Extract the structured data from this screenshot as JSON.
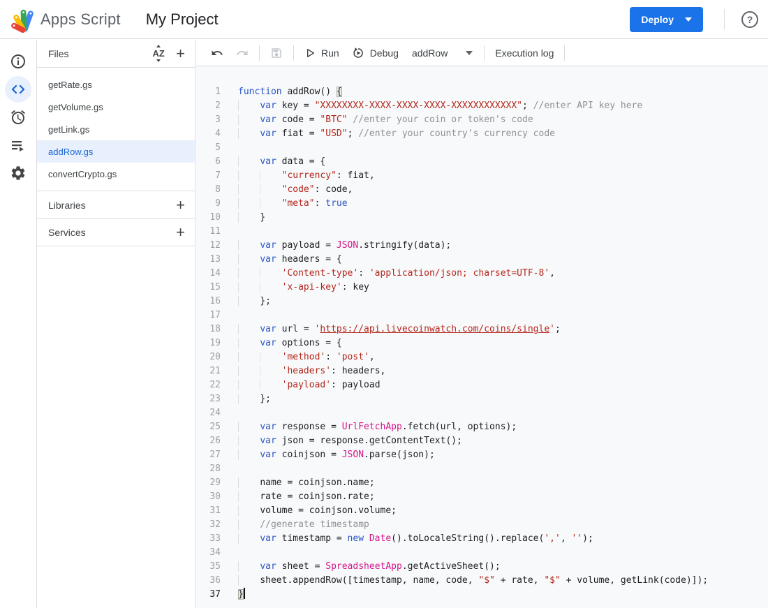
{
  "header": {
    "product": "Apps Script",
    "title": "My Project",
    "deploy_label": "Deploy",
    "help_icon": "help-icon"
  },
  "rail": {
    "items": [
      "overview",
      "editor",
      "triggers",
      "executions",
      "settings"
    ],
    "selected": "editor",
    "selected_color": "#1967d2",
    "icon_color": "#444746"
  },
  "files_panel": {
    "title": "Files",
    "sort_icon": "AZ",
    "files": [
      {
        "name": "getRate.gs",
        "selected": false
      },
      {
        "name": "getVolume.gs",
        "selected": false
      },
      {
        "name": "getLink.gs",
        "selected": false
      },
      {
        "name": "addRow.gs",
        "selected": true
      },
      {
        "name": "convertCrypto.gs",
        "selected": false
      }
    ],
    "sections": [
      {
        "label": "Libraries"
      },
      {
        "label": "Services"
      }
    ]
  },
  "toolbar": {
    "run_label": "Run",
    "debug_label": "Debug",
    "function_selector_value": "addRow",
    "execution_log_label": "Execution log"
  },
  "editor": {
    "active_line": 37,
    "syntax_colors": {
      "keyword": "#2a56c6",
      "string": "#b3261c",
      "comment": "#8e9297",
      "builtin": "#d6158a",
      "plain": "#202124"
    },
    "lines": [
      {
        "n": 1,
        "t": [
          [
            "k",
            "function"
          ],
          [
            "p",
            " addRow() "
          ],
          [
            "hb",
            "{"
          ]
        ]
      },
      {
        "n": 2,
        "t": [
          [
            "w",
            "    "
          ],
          [
            "k",
            "var"
          ],
          [
            "p",
            " key = "
          ],
          [
            "s",
            "\"XXXXXXXX-XXXX-XXXX-XXXX-XXXXXXXXXXXX\""
          ],
          [
            "p",
            "; "
          ],
          [
            "c",
            "//enter API key here"
          ]
        ]
      },
      {
        "n": 3,
        "t": [
          [
            "w",
            "    "
          ],
          [
            "k",
            "var"
          ],
          [
            "p",
            " code = "
          ],
          [
            "s",
            "\"BTC\""
          ],
          [
            "p",
            " "
          ],
          [
            "c",
            "//enter your coin or token's code"
          ]
        ]
      },
      {
        "n": 4,
        "t": [
          [
            "w",
            "    "
          ],
          [
            "k",
            "var"
          ],
          [
            "p",
            " fiat = "
          ],
          [
            "s",
            "\"USD\""
          ],
          [
            "p",
            "; "
          ],
          [
            "c",
            "//enter your country's currency code"
          ]
        ]
      },
      {
        "n": 5,
        "t": []
      },
      {
        "n": 6,
        "t": [
          [
            "w",
            "    "
          ],
          [
            "k",
            "var"
          ],
          [
            "p",
            " data = {"
          ]
        ]
      },
      {
        "n": 7,
        "t": [
          [
            "w",
            "    "
          ],
          [
            "w",
            "    "
          ],
          [
            "s",
            "\"currency\""
          ],
          [
            "p",
            ": fiat,"
          ]
        ]
      },
      {
        "n": 8,
        "t": [
          [
            "w",
            "    "
          ],
          [
            "w",
            "    "
          ],
          [
            "s",
            "\"code\""
          ],
          [
            "p",
            ": code,"
          ]
        ]
      },
      {
        "n": 9,
        "t": [
          [
            "w",
            "    "
          ],
          [
            "w",
            "    "
          ],
          [
            "s",
            "\"meta\""
          ],
          [
            "p",
            ": "
          ],
          [
            "k",
            "true"
          ]
        ]
      },
      {
        "n": 10,
        "t": [
          [
            "w",
            "    "
          ],
          [
            "p",
            "}"
          ]
        ]
      },
      {
        "n": 11,
        "t": []
      },
      {
        "n": 12,
        "t": [
          [
            "w",
            "    "
          ],
          [
            "k",
            "var"
          ],
          [
            "p",
            " payload = "
          ],
          [
            "b",
            "JSON"
          ],
          [
            "p",
            ".stringify(data);"
          ]
        ]
      },
      {
        "n": 13,
        "t": [
          [
            "w",
            "    "
          ],
          [
            "k",
            "var"
          ],
          [
            "p",
            " headers = {"
          ]
        ]
      },
      {
        "n": 14,
        "t": [
          [
            "w",
            "    "
          ],
          [
            "w",
            "    "
          ],
          [
            "s",
            "'Content-type'"
          ],
          [
            "p",
            ": "
          ],
          [
            "s",
            "'application/json; charset=UTF-8'"
          ],
          [
            "p",
            ","
          ]
        ]
      },
      {
        "n": 15,
        "t": [
          [
            "w",
            "    "
          ],
          [
            "w",
            "    "
          ],
          [
            "s",
            "'x-api-key'"
          ],
          [
            "p",
            ": key"
          ]
        ]
      },
      {
        "n": 16,
        "t": [
          [
            "w",
            "    "
          ],
          [
            "p",
            "};"
          ]
        ]
      },
      {
        "n": 17,
        "t": []
      },
      {
        "n": 18,
        "t": [
          [
            "w",
            "    "
          ],
          [
            "k",
            "var"
          ],
          [
            "p",
            " url = "
          ],
          [
            "s",
            "'"
          ],
          [
            "u",
            "https://api.livecoinwatch.com/coins/single"
          ],
          [
            "s",
            "'"
          ],
          [
            "p",
            ";"
          ]
        ]
      },
      {
        "n": 19,
        "t": [
          [
            "w",
            "    "
          ],
          [
            "k",
            "var"
          ],
          [
            "p",
            " options = {"
          ]
        ]
      },
      {
        "n": 20,
        "t": [
          [
            "w",
            "    "
          ],
          [
            "w",
            "    "
          ],
          [
            "s",
            "'method'"
          ],
          [
            "p",
            ": "
          ],
          [
            "s",
            "'post'"
          ],
          [
            "p",
            ","
          ]
        ]
      },
      {
        "n": 21,
        "t": [
          [
            "w",
            "    "
          ],
          [
            "w",
            "    "
          ],
          [
            "s",
            "'headers'"
          ],
          [
            "p",
            ": headers,"
          ]
        ]
      },
      {
        "n": 22,
        "t": [
          [
            "w",
            "    "
          ],
          [
            "w",
            "    "
          ],
          [
            "s",
            "'payload'"
          ],
          [
            "p",
            ": payload"
          ]
        ]
      },
      {
        "n": 23,
        "t": [
          [
            "w",
            "    "
          ],
          [
            "p",
            "};"
          ]
        ]
      },
      {
        "n": 24,
        "t": []
      },
      {
        "n": 25,
        "t": [
          [
            "w",
            "    "
          ],
          [
            "k",
            "var"
          ],
          [
            "p",
            " response = "
          ],
          [
            "b",
            "UrlFetchApp"
          ],
          [
            "p",
            ".fetch(url, options);"
          ]
        ]
      },
      {
        "n": 26,
        "t": [
          [
            "w",
            "    "
          ],
          [
            "k",
            "var"
          ],
          [
            "p",
            " json = response.getContentText();"
          ]
        ]
      },
      {
        "n": 27,
        "t": [
          [
            "w",
            "    "
          ],
          [
            "k",
            "var"
          ],
          [
            "p",
            " coinjson = "
          ],
          [
            "b",
            "JSON"
          ],
          [
            "p",
            ".parse(json);"
          ]
        ]
      },
      {
        "n": 28,
        "t": []
      },
      {
        "n": 29,
        "t": [
          [
            "w",
            "    "
          ],
          [
            "p",
            "name = coinjson.name;"
          ]
        ]
      },
      {
        "n": 30,
        "t": [
          [
            "w",
            "    "
          ],
          [
            "p",
            "rate = coinjson.rate;"
          ]
        ]
      },
      {
        "n": 31,
        "t": [
          [
            "w",
            "    "
          ],
          [
            "p",
            "volume = coinjson.volume;"
          ]
        ]
      },
      {
        "n": 32,
        "t": [
          [
            "w",
            "    "
          ],
          [
            "c",
            "//generate timestamp"
          ]
        ]
      },
      {
        "n": 33,
        "t": [
          [
            "w",
            "    "
          ],
          [
            "k",
            "var"
          ],
          [
            "p",
            " timestamp = "
          ],
          [
            "k",
            "new"
          ],
          [
            "p",
            " "
          ],
          [
            "b",
            "Date"
          ],
          [
            "p",
            "().toLocaleString().replace("
          ],
          [
            "s",
            "','"
          ],
          [
            "p",
            ", "
          ],
          [
            "s",
            "''"
          ],
          [
            "p",
            ");"
          ]
        ]
      },
      {
        "n": 34,
        "t": []
      },
      {
        "n": 35,
        "t": [
          [
            "w",
            "    "
          ],
          [
            "k",
            "var"
          ],
          [
            "p",
            " sheet = "
          ],
          [
            "b",
            "SpreadsheetApp"
          ],
          [
            "p",
            ".getActiveSheet();"
          ]
        ]
      },
      {
        "n": 36,
        "t": [
          [
            "w",
            "    "
          ],
          [
            "p",
            "sheet.appendRow([timestamp, name, code, "
          ],
          [
            "s",
            "\"$\""
          ],
          [
            "p",
            " + rate, "
          ],
          [
            "s",
            "\"$\""
          ],
          [
            "p",
            " + volume, getLink(code)]);"
          ]
        ]
      },
      {
        "n": 37,
        "t": [
          [
            "hb",
            "}"
          ],
          [
            "cur",
            ""
          ]
        ]
      }
    ]
  }
}
